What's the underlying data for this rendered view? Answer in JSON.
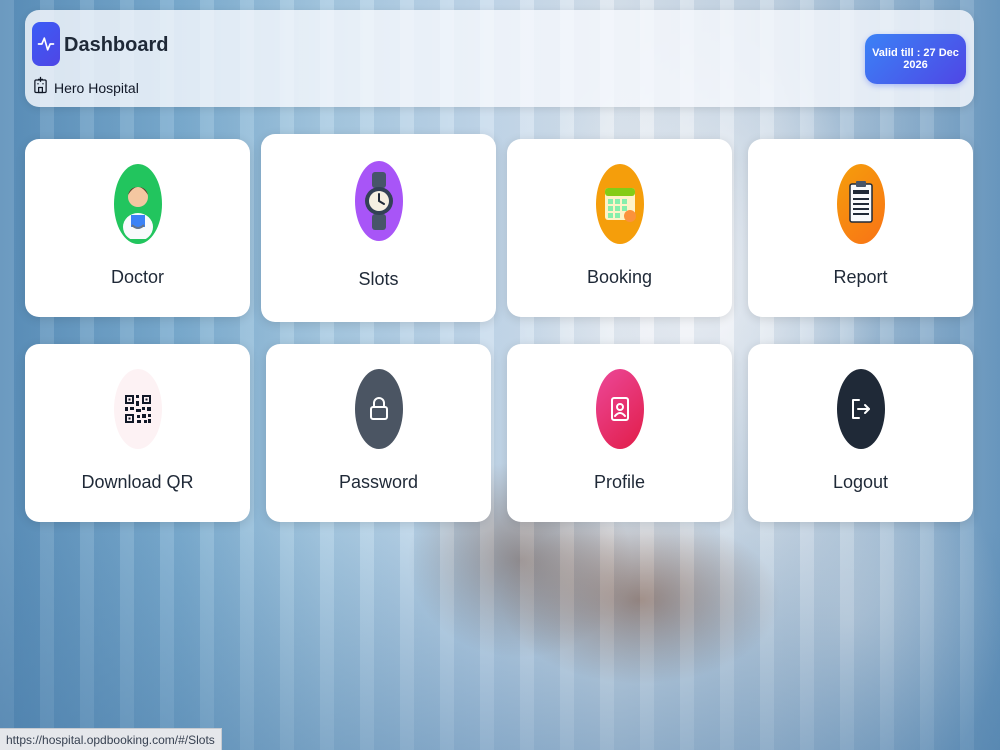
{
  "header": {
    "title": "Dashboard",
    "hospital_name": "Hero Hospital",
    "valid_badge": "Valid till : 27 Dec 2026",
    "logo_icon": "activity-pulse-icon",
    "hospital_icon": "hospital-building-icon"
  },
  "tiles": [
    {
      "label": "Doctor",
      "icon": "doctor-icon",
      "color": "#22c55e"
    },
    {
      "label": "Slots",
      "icon": "watch-icon",
      "color": "#a855f7"
    },
    {
      "label": "Booking",
      "icon": "calendar-icon",
      "color": "#f59e0b"
    },
    {
      "label": "Report",
      "icon": "clipboard-report-icon",
      "color": "#f97316"
    },
    {
      "label": "Download QR",
      "icon": "qr-code-icon",
      "color": "#fdf2f4"
    },
    {
      "label": "Password",
      "icon": "lock-icon",
      "color": "#4b5563"
    },
    {
      "label": "Profile",
      "icon": "id-badge-icon",
      "color": "#e11d48"
    },
    {
      "label": "Logout",
      "icon": "logout-icon",
      "color": "#1f2937"
    }
  ],
  "status_url": "https://hospital.opdbooking.com/#/Slots"
}
